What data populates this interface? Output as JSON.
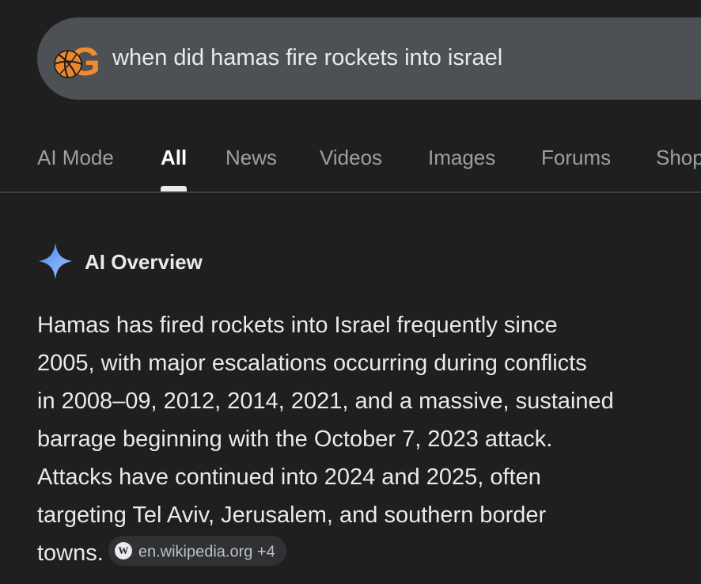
{
  "search": {
    "query": "when did hamas fire rockets into israel",
    "logo_icon": "basketball-google-logo-icon"
  },
  "tabs": [
    {
      "label": "AI Mode",
      "active": false
    },
    {
      "label": "All",
      "active": true
    },
    {
      "label": "News",
      "active": false
    },
    {
      "label": "Videos",
      "active": false
    },
    {
      "label": "Images",
      "active": false
    },
    {
      "label": "Forums",
      "active": false
    },
    {
      "label": "Shop",
      "active": false
    }
  ],
  "ai_overview": {
    "icon": "sparkle-icon",
    "title": "AI Overview",
    "lines": [
      "Hamas has fired rockets into Israel frequently since",
      "2005, with major escalations occurring during conflicts",
      "in 2008–09, 2012, 2014, 2021, and a massive, sustained",
      "barrage beginning with the October 7, 2023 attack.",
      "Attacks have continued into 2024 and 2025, often",
      "targeting Tel Aviv, Jerusalem, and southern border",
      "towns."
    ],
    "source_chip": {
      "icon_letter": "W",
      "label": "en.wikipedia.org +4"
    }
  },
  "colors": {
    "background": "#1f1f1f",
    "search_bar": "#4d5156",
    "text_primary": "#e8eaed",
    "text_secondary": "#9aa0a6",
    "sparkle": "#8ab4f8",
    "logo_orange": "#f28b30"
  }
}
